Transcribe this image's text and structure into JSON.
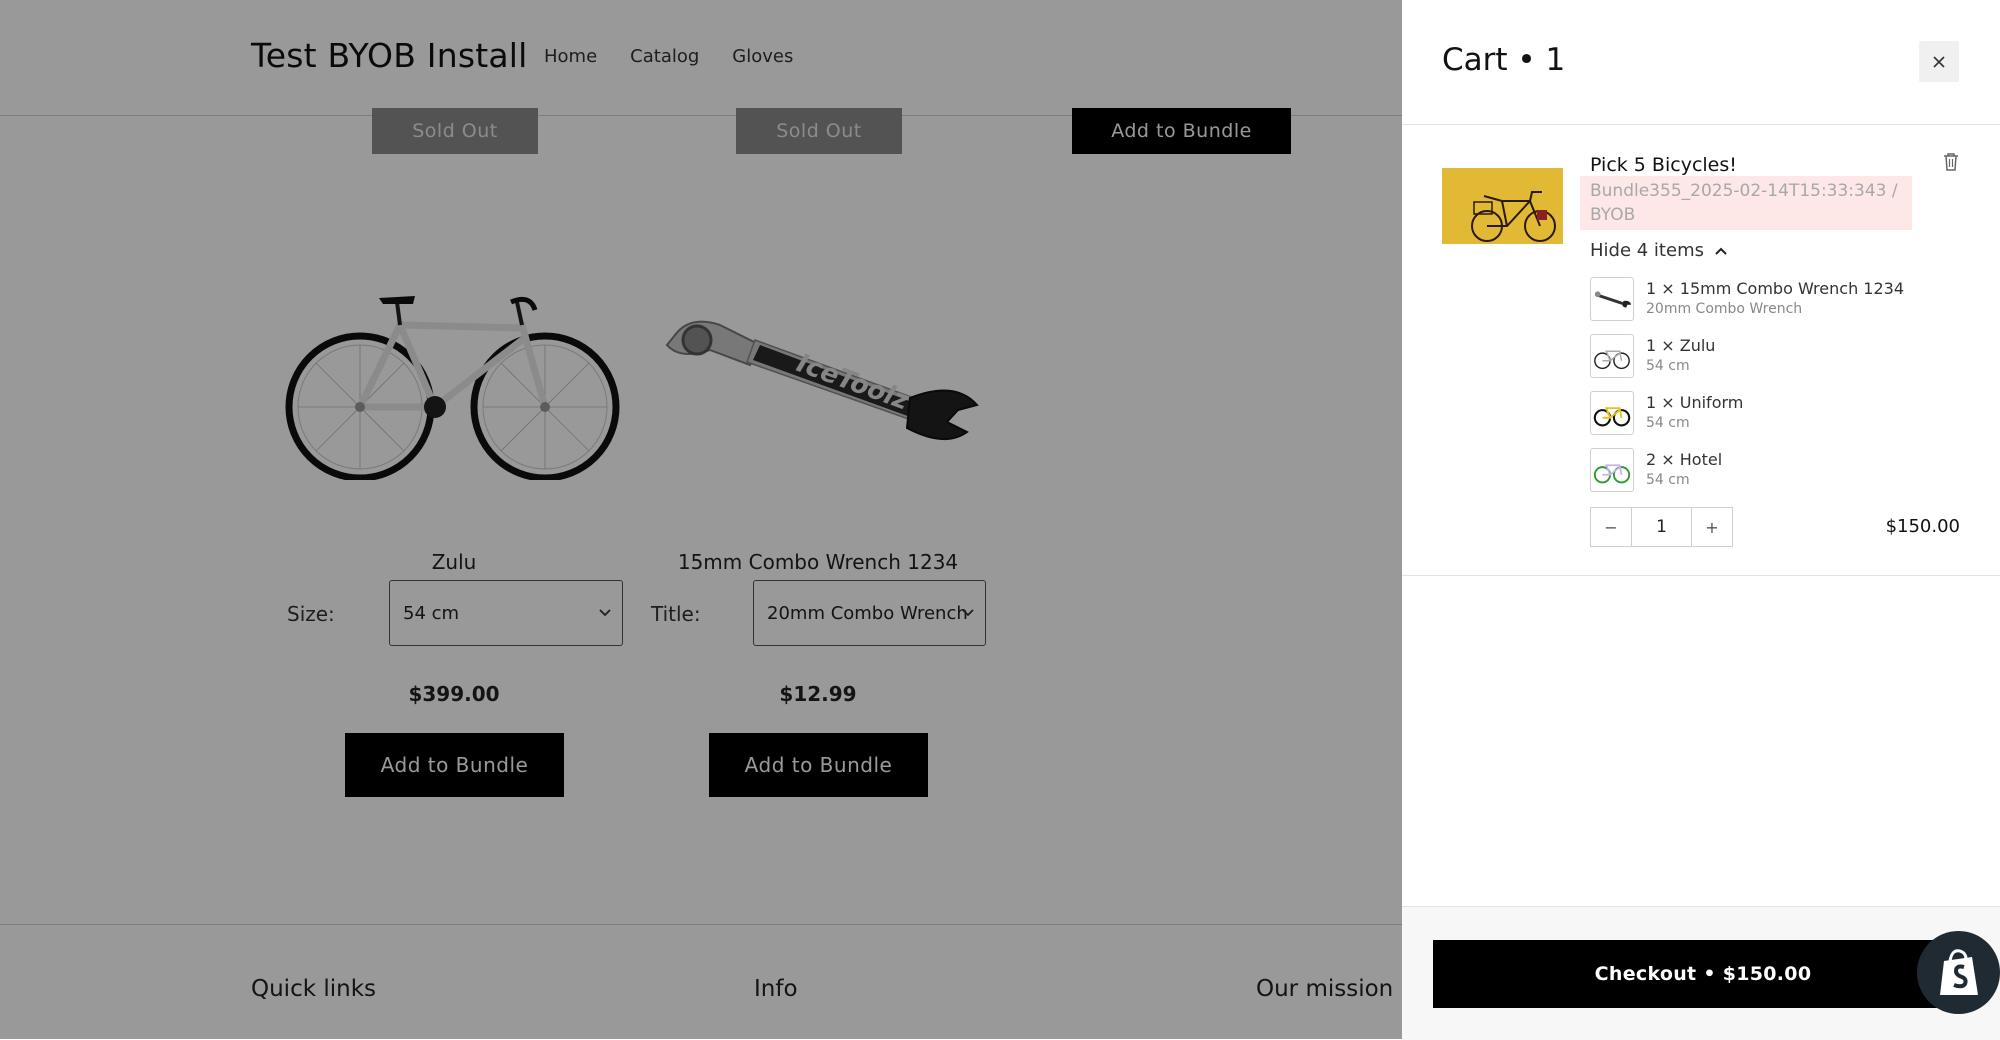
{
  "store": {
    "logo": "Test BYOB Install",
    "nav": [
      "Home",
      "Catalog",
      "Gloves"
    ],
    "top_buttons": [
      "Sold Out",
      "Sold Out",
      "Add to Bundle"
    ],
    "products": [
      {
        "title": "Zulu",
        "option_label": "Size:",
        "option_value": "54 cm",
        "price": "$399.00",
        "button": "Add to Bundle"
      },
      {
        "title": "15mm Combo Wrench 1234",
        "option_label": "Title:",
        "option_value": "20mm Combo Wrench",
        "price": "$12.99",
        "button": "Add to Bundle"
      }
    ],
    "footer": [
      "Quick links",
      "Info",
      "Our mission"
    ]
  },
  "cart": {
    "title": "Cart • 1",
    "bundle_name": "Pick 5 Bicycles!",
    "bundle_sub": "Bundle355_2025-02-14T15:33:343 / BYOB",
    "hide_items": "Hide 4 items",
    "items": [
      {
        "name": "1 × 15mm Combo Wrench 1234",
        "variant": "20mm Combo Wrench",
        "icon": "wrench-thumbnail"
      },
      {
        "name": "1 × Zulu",
        "variant": "54 cm",
        "icon": "white-bicycle-thumbnail"
      },
      {
        "name": "1 × Uniform",
        "variant": "54 cm",
        "icon": "yellow-bicycle-thumbnail"
      },
      {
        "name": "2 × Hotel",
        "variant": "54 cm",
        "icon": "green-bicycle-thumbnail"
      }
    ],
    "quantity": "1",
    "minus": "−",
    "plus": "+",
    "line_price": "$150.00",
    "checkout": "Checkout • $150.00"
  },
  "colors": {
    "overlay": "rgba(0,0,0,0.40)",
    "button": "#000000",
    "highlight": "#fde7e7"
  }
}
